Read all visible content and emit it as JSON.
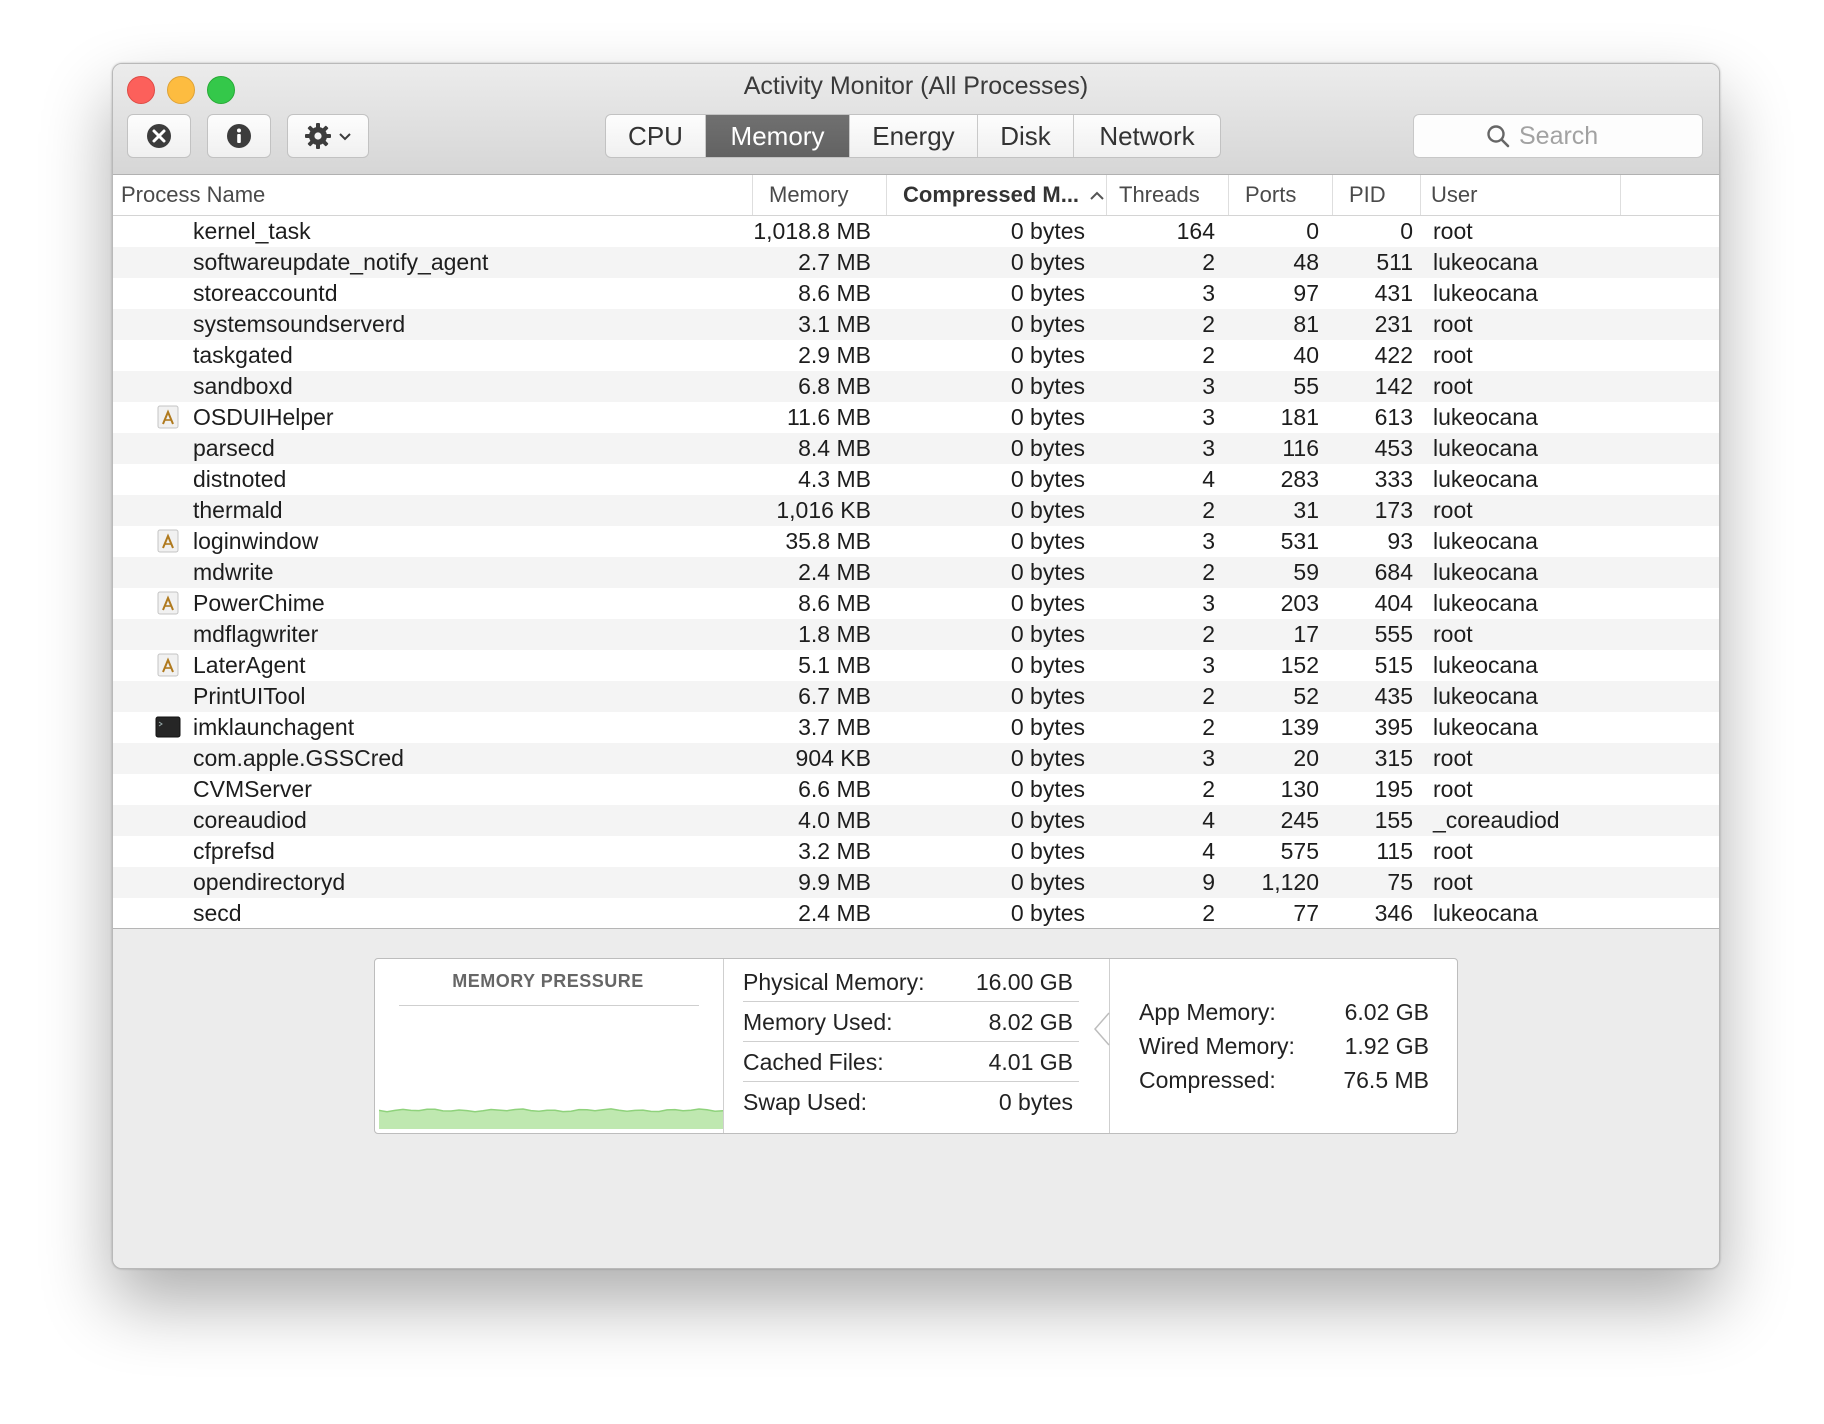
{
  "window": {
    "title": "Activity Monitor (All Processes)"
  },
  "toolbar": {
    "quit_process": "stop-process-icon",
    "inspect": "info-icon",
    "action": "gear-menu-icon",
    "tabs": [
      {
        "label": "CPU",
        "active": false
      },
      {
        "label": "Memory",
        "active": true
      },
      {
        "label": "Energy",
        "active": false
      },
      {
        "label": "Disk",
        "active": false
      },
      {
        "label": "Network",
        "active": false
      }
    ],
    "search_placeholder": "Search"
  },
  "table": {
    "columns": {
      "name": "Process Name",
      "memory": "Memory",
      "compressed": "Compressed M...",
      "threads": "Threads",
      "ports": "Ports",
      "pid": "PID",
      "user": "User"
    },
    "sort_icon": "sort-ascending-icon",
    "rows": [
      {
        "name": "kernel_task",
        "icon": "",
        "memory": "1,018.8 MB",
        "compressed": "0 bytes",
        "threads": "164",
        "ports": "0",
        "pid": "0",
        "user": "root"
      },
      {
        "name": "softwareupdate_notify_agent",
        "icon": "",
        "memory": "2.7 MB",
        "compressed": "0 bytes",
        "threads": "2",
        "ports": "48",
        "pid": "511",
        "user": "lukeocana"
      },
      {
        "name": "storeaccountd",
        "icon": "",
        "memory": "8.6 MB",
        "compressed": "0 bytes",
        "threads": "3",
        "ports": "97",
        "pid": "431",
        "user": "lukeocana"
      },
      {
        "name": "systemsoundserverd",
        "icon": "",
        "memory": "3.1 MB",
        "compressed": "0 bytes",
        "threads": "2",
        "ports": "81",
        "pid": "231",
        "user": "root"
      },
      {
        "name": "taskgated",
        "icon": "",
        "memory": "2.9 MB",
        "compressed": "0 bytes",
        "threads": "2",
        "ports": "40",
        "pid": "422",
        "user": "root"
      },
      {
        "name": "sandboxd",
        "icon": "",
        "memory": "6.8 MB",
        "compressed": "0 bytes",
        "threads": "3",
        "ports": "55",
        "pid": "142",
        "user": "root"
      },
      {
        "name": "OSDUIHelper",
        "icon": "generic-app-icon",
        "memory": "11.6 MB",
        "compressed": "0 bytes",
        "threads": "3",
        "ports": "181",
        "pid": "613",
        "user": "lukeocana"
      },
      {
        "name": "parsecd",
        "icon": "",
        "memory": "8.4 MB",
        "compressed": "0 bytes",
        "threads": "3",
        "ports": "116",
        "pid": "453",
        "user": "lukeocana"
      },
      {
        "name": "distnoted",
        "icon": "",
        "memory": "4.3 MB",
        "compressed": "0 bytes",
        "threads": "4",
        "ports": "283",
        "pid": "333",
        "user": "lukeocana"
      },
      {
        "name": "thermald",
        "icon": "",
        "memory": "1,016 KB",
        "compressed": "0 bytes",
        "threads": "2",
        "ports": "31",
        "pid": "173",
        "user": "root"
      },
      {
        "name": "loginwindow",
        "icon": "generic-app-icon",
        "memory": "35.8 MB",
        "compressed": "0 bytes",
        "threads": "3",
        "ports": "531",
        "pid": "93",
        "user": "lukeocana"
      },
      {
        "name": "mdwrite",
        "icon": "",
        "memory": "2.4 MB",
        "compressed": "0 bytes",
        "threads": "2",
        "ports": "59",
        "pid": "684",
        "user": "lukeocana"
      },
      {
        "name": "PowerChime",
        "icon": "generic-app-icon",
        "memory": "8.6 MB",
        "compressed": "0 bytes",
        "threads": "3",
        "ports": "203",
        "pid": "404",
        "user": "lukeocana"
      },
      {
        "name": "mdflagwriter",
        "icon": "",
        "memory": "1.8 MB",
        "compressed": "0 bytes",
        "threads": "2",
        "ports": "17",
        "pid": "555",
        "user": "root"
      },
      {
        "name": "LaterAgent",
        "icon": "generic-app-icon",
        "memory": "5.1 MB",
        "compressed": "0 bytes",
        "threads": "3",
        "ports": "152",
        "pid": "515",
        "user": "lukeocana"
      },
      {
        "name": "PrintUITool",
        "icon": "",
        "memory": "6.7 MB",
        "compressed": "0 bytes",
        "threads": "2",
        "ports": "52",
        "pid": "435",
        "user": "lukeocana"
      },
      {
        "name": "imklaunchagent",
        "icon": "terminal-icon",
        "memory": "3.7 MB",
        "compressed": "0 bytes",
        "threads": "2",
        "ports": "139",
        "pid": "395",
        "user": "lukeocana"
      },
      {
        "name": "com.apple.GSSCred",
        "icon": "",
        "memory": "904 KB",
        "compressed": "0 bytes",
        "threads": "3",
        "ports": "20",
        "pid": "315",
        "user": "root"
      },
      {
        "name": "CVMServer",
        "icon": "",
        "memory": "6.6 MB",
        "compressed": "0 bytes",
        "threads": "2",
        "ports": "130",
        "pid": "195",
        "user": "root"
      },
      {
        "name": "coreaudiod",
        "icon": "",
        "memory": "4.0 MB",
        "compressed": "0 bytes",
        "threads": "4",
        "ports": "245",
        "pid": "155",
        "user": "_coreaudiod"
      },
      {
        "name": "cfprefsd",
        "icon": "",
        "memory": "3.2 MB",
        "compressed": "0 bytes",
        "threads": "4",
        "ports": "575",
        "pid": "115",
        "user": "root"
      },
      {
        "name": "opendirectoryd",
        "icon": "",
        "memory": "9.9 MB",
        "compressed": "0 bytes",
        "threads": "9",
        "ports": "1,120",
        "pid": "75",
        "user": "root"
      },
      {
        "name": "secd",
        "icon": "",
        "memory": "2.4 MB",
        "compressed": "0 bytes",
        "threads": "2",
        "ports": "77",
        "pid": "346",
        "user": "lukeocana"
      }
    ]
  },
  "memory_pressure": {
    "title": "MEMORY PRESSURE",
    "color": "#bfe8b0",
    "line_color": "#8fd27c",
    "level": 0.25
  },
  "stats": [
    {
      "label": "Physical Memory:",
      "value": "16.00 GB"
    },
    {
      "label": "Memory Used:",
      "value": "8.02 GB"
    },
    {
      "label": "Cached Files:",
      "value": "4.01 GB"
    },
    {
      "label": "Swap Used:",
      "value": "0 bytes"
    }
  ],
  "breakdown": [
    {
      "label": "App Memory:",
      "value": "6.02 GB"
    },
    {
      "label": "Wired Memory:",
      "value": "1.92 GB"
    },
    {
      "label": "Compressed:",
      "value": "76.5 MB"
    }
  ]
}
